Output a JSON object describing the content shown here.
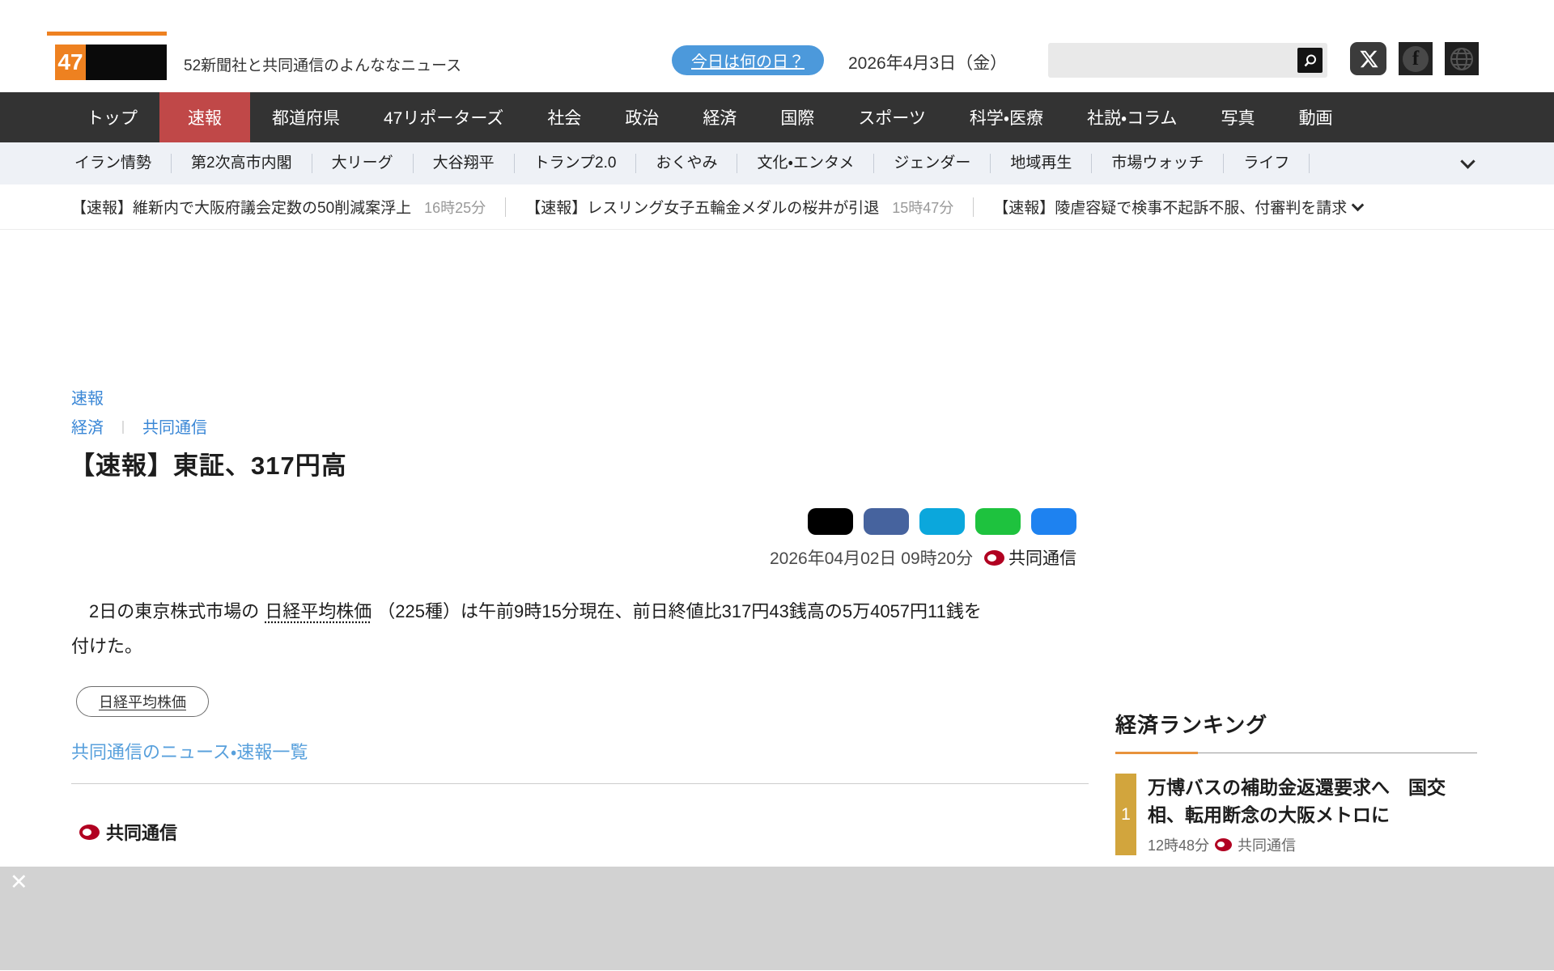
{
  "brand": {
    "logo_number": "47",
    "tagline": "52新聞社と共同通信のよんななニュース"
  },
  "header": {
    "today_button": "今日は何の日？",
    "date": "2026年4月3日（金）",
    "search_placeholder": ""
  },
  "main_nav": {
    "items": [
      {
        "label": "トップ"
      },
      {
        "label": "速報"
      },
      {
        "label": "都道府県"
      },
      {
        "label": "47リポーターズ"
      },
      {
        "label": "社会"
      },
      {
        "label": "政治"
      },
      {
        "label": "経済"
      },
      {
        "label": "国際"
      },
      {
        "label": "スポーツ"
      },
      {
        "label": "科学・医療"
      },
      {
        "label": "社説・コラム"
      },
      {
        "label": "写真"
      },
      {
        "label": "動画"
      }
    ]
  },
  "sub_nav": {
    "items": [
      {
        "label": "イラン情勢"
      },
      {
        "label": "第2次高市内閣"
      },
      {
        "label": "大リーグ"
      },
      {
        "label": "大谷翔平"
      },
      {
        "label": "トランプ2.0"
      },
      {
        "label": "おくやみ"
      },
      {
        "label": "文化・エンタメ"
      },
      {
        "label": "ジェンダー"
      },
      {
        "label": "地域再生"
      },
      {
        "label": "市場ウォッチ"
      },
      {
        "label": "ライフ"
      }
    ]
  },
  "ticker": {
    "items": [
      {
        "title": "【速報】維新内で大阪府議会定数の50削減案浮上",
        "time": "16時25分"
      },
      {
        "title": "【速報】レスリング女子五輪金メダルの桜井が引退",
        "time": "15時47分"
      },
      {
        "title": "【速報】陵虐容疑で検事不起訴不服、付審判を請求",
        "time": ""
      }
    ]
  },
  "article": {
    "breadcrumb_top": "速報",
    "breadcrumb_category": "経済",
    "breadcrumb_sep": "｜",
    "breadcrumb_source": "共同通信",
    "title": "【速報】東証、317円高",
    "published": "2026年04月02日 09時20分",
    "source": "共同通信",
    "body_pre": "　2日の東京株式市場の",
    "body_link": "日経平均株価",
    "body_post": "（225種）は午前9時15分現在、前日終値比317円43銭高の5万4057円11銭を付けた。",
    "tag": "日経平均株価",
    "more_link": "共同通信のニュース・速報一覧",
    "footer_source": "共同通信"
  },
  "share_buttons": {
    "colors": [
      "#000000",
      "#46639e",
      "#0ba7dc",
      "#1ec23e",
      "#1e82f0"
    ]
  },
  "sidebar": {
    "heading": "経済ランキング",
    "items": [
      {
        "rank": "1",
        "title": "万博バスの補助金返還要求へ　国交相、転用断念の大阪メトロに",
        "time": "12時48分",
        "source": "共同通信"
      }
    ]
  },
  "banner": {
    "close": "✕"
  },
  "colors": {
    "brand_orange": "#ee8120",
    "nav_dark": "#333333",
    "nav_active_red": "#c04848",
    "link_blue": "#3a87d6",
    "kyodo_red": "#b10021",
    "rank_gold": "#d2a53d",
    "banner_gray": "#d2d2d2"
  }
}
